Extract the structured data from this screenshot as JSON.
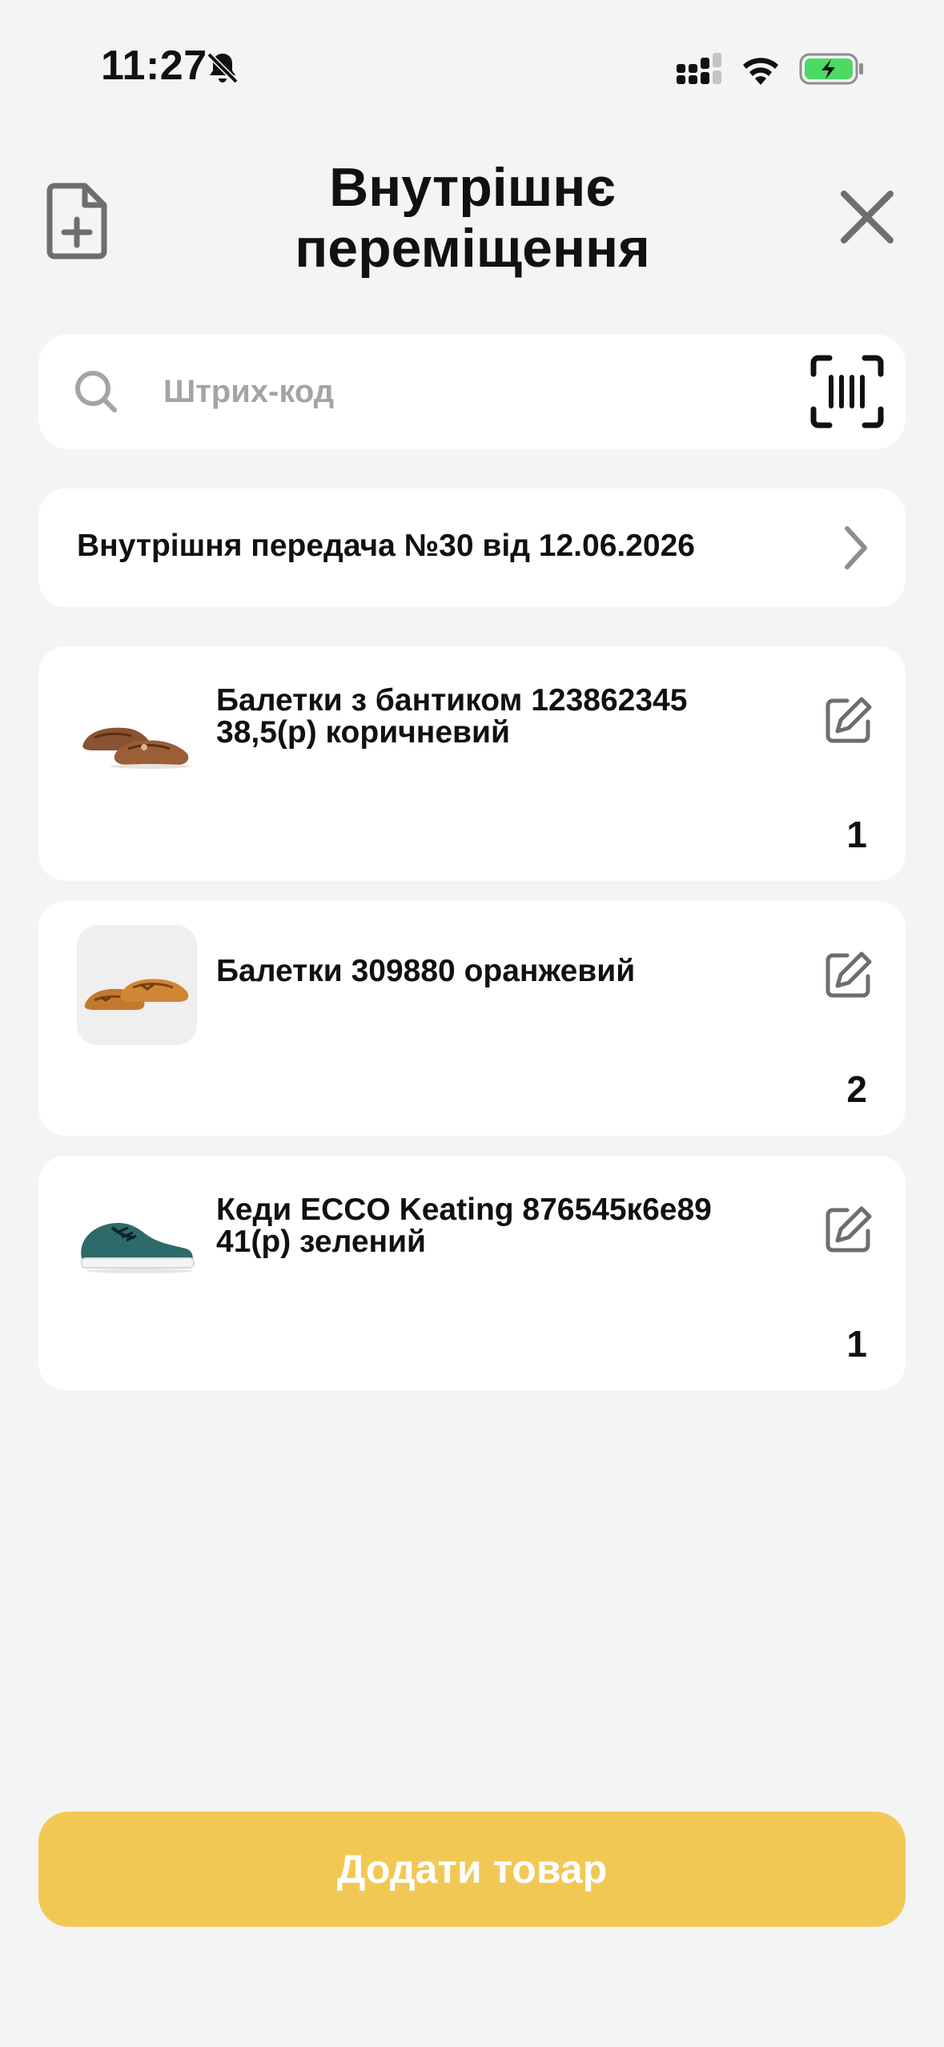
{
  "status_bar": {
    "time": "11:27"
  },
  "header": {
    "title": "Внутрішнє переміщення"
  },
  "search": {
    "placeholder": "Штрих-код",
    "value": ""
  },
  "document": {
    "label": "Внутрішня передача №30 від 12.06.2026"
  },
  "products": [
    {
      "name": "Балетки з бантиком 123862345 38,5(р) коричневий",
      "quantity": "1",
      "image": "brown-ballet-flats"
    },
    {
      "name": "Балетки 309880 оранжевий",
      "quantity": "2",
      "image": "orange-ballet-flats"
    },
    {
      "name": "Кеди ECCO Keating 876545к6е89 41(р) зелений",
      "quantity": "1",
      "image": "green-sneakers"
    }
  ],
  "actions": {
    "add_product_label": "Додати товар"
  },
  "colors": {
    "background": "#f4f4f4",
    "card": "#ffffff",
    "accent": "#f2c855",
    "icon_gray": "#6e6e6e",
    "placeholder": "#a4a4a4",
    "battery_green": "#4cd964"
  }
}
